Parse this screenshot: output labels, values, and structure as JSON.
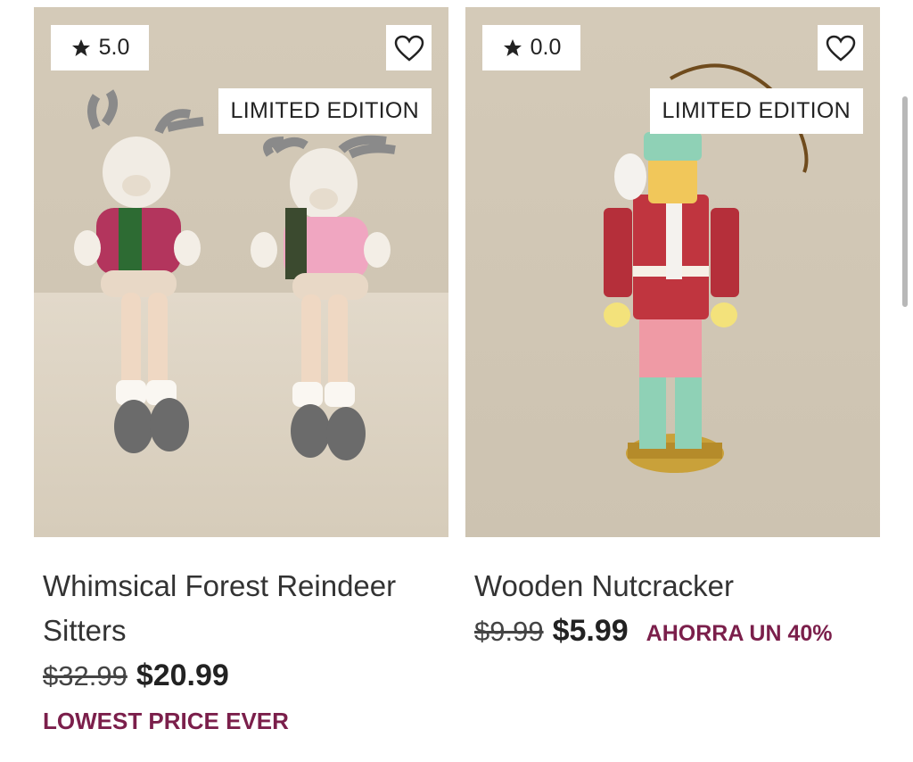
{
  "products": [
    {
      "rating": "5.0",
      "badge": "LIMITED EDITION",
      "title": "Whimsical Forest Reindeer Sitters",
      "old_price": "$32.99",
      "new_price": "$20.99",
      "promo": "LOWEST PRICE EVER"
    },
    {
      "rating": "0.0",
      "badge": "LIMITED EDITION",
      "title": "Wooden Nutcracker",
      "old_price": "$9.99",
      "new_price": "$5.99",
      "savings": "AHORRA UN 40%"
    }
  ],
  "icons": {
    "rating": "star-icon",
    "favorite": "heart-icon"
  },
  "colors": {
    "accent": "#7b1f4b",
    "image_bg": "#d0c6b4"
  }
}
